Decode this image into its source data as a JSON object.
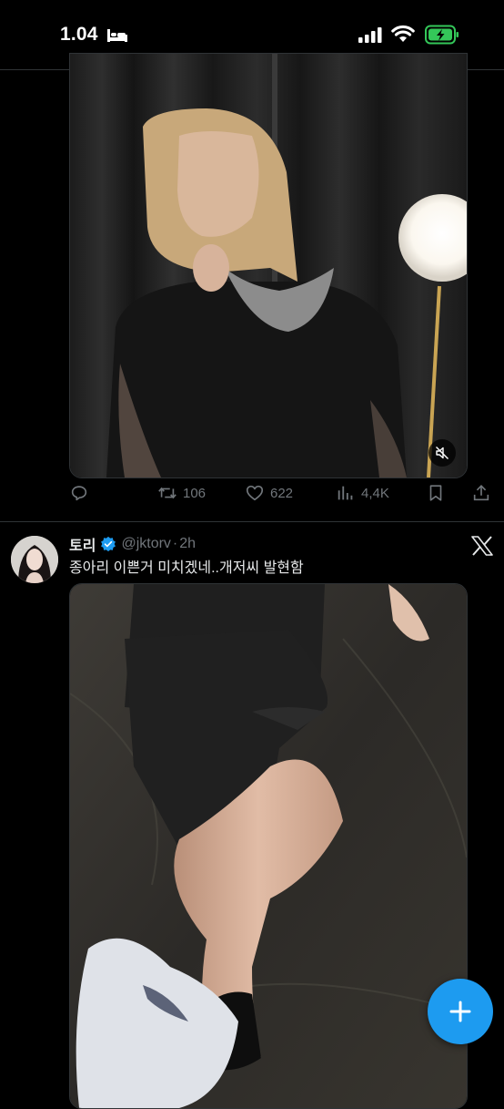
{
  "status_bar": {
    "time": "1.04",
    "icons": [
      "sleep-icon",
      "signal-icon",
      "wifi-icon",
      "battery-charging-icon"
    ],
    "battery_color": "#34c759"
  },
  "tweet1": {
    "media": "video-thumbnail",
    "actions": {
      "retweets": "106",
      "likes": "622",
      "views": "4,4K"
    }
  },
  "tweet2": {
    "display_name": "토리",
    "verified": true,
    "handle": "@jktorv",
    "separator": "·",
    "time": "2h",
    "text": "종아리 이쁜거 미치겠네..개저씨 발현함",
    "media": "photo"
  },
  "colors": {
    "accent": "#1d9bf0",
    "muted": "#71767b",
    "background": "#000000"
  }
}
